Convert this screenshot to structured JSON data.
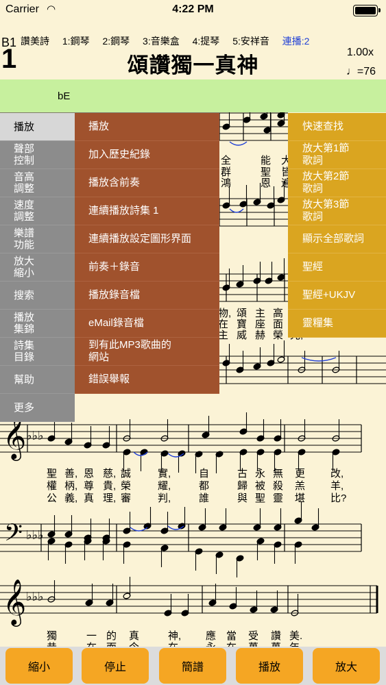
{
  "status": {
    "carrier": "Carrier",
    "time": "4:22 PM"
  },
  "header": {
    "book": "B1",
    "number": "1",
    "title": "頌讚獨一真神",
    "speed": "1.00x",
    "tempo": "♩=76",
    "key": "bE",
    "tracks": [
      "讚美詩",
      "1:鋼琴",
      "2:鋼琴",
      "3:音樂盒",
      "4:提琴",
      "5:安祥音"
    ],
    "lianbo": "連播:2"
  },
  "menu_left": [
    "播放",
    "聲部\n控制",
    "音高\n調整",
    "速度\n調整",
    "樂譜\n功能",
    "放大\n縮小",
    "搜索",
    "播放\n集錦",
    "詩集\n目錄",
    "幫助",
    "更多"
  ],
  "menu_mid": [
    "播放",
    "加入歷史紀錄",
    "播放含前奏",
    "連續播放詩集 1",
    "連續播放設定圖形界面",
    "前奏＋錄音",
    "播放錄音檔",
    "eMail錄音檔",
    "到有此MP3歌曲的\n網站",
    "錯誤舉報"
  ],
  "menu_right": [
    "快速查找",
    "放大第1節\n歌詞",
    "放大第2節\n歌詞",
    "放大第3節\n歌詞",
    "顯示全部歌詞",
    "聖經",
    "聖經+UKJV",
    "靈糧集"
  ],
  "lyrics": {
    "row1": [
      "全",
      "能",
      "大"
    ],
    "row2": [
      "群",
      "聖",
      "皆"
    ],
    "row3": [
      "鴻",
      "恩",
      "遍"
    ],
    "row4": [
      "物,",
      "頌",
      "主",
      "高",
      "而"
    ],
    "row5": [
      "在",
      "寶",
      "座",
      "面"
    ],
    "row6": [
      "主",
      "威",
      "赫",
      "榮",
      "光,"
    ],
    "line2_v1": [
      "聖",
      "善,",
      "恩",
      "慈,",
      "誠",
      "實,",
      "自",
      "古",
      "永",
      "無",
      "更",
      "改,"
    ],
    "line2_v2": [
      "權",
      "柄,",
      "尊",
      "貴,",
      "榮",
      "耀,",
      "都",
      "歸",
      "被",
      "殺",
      "羔",
      "羊,"
    ],
    "line2_v3": [
      "公",
      "義,",
      "真",
      "理,",
      "審",
      "判,",
      "誰",
      "與",
      "聖",
      "靈",
      "堪",
      "比?"
    ],
    "line3_v1": [
      "獨",
      "一",
      "的",
      "真",
      "神,",
      "應",
      "當",
      "受",
      "讚",
      "美."
    ],
    "line3_v2": [
      "昔",
      "在",
      "而",
      "今",
      "在,",
      "永",
      "在",
      "萬",
      "萬",
      "年."
    ]
  },
  "bottom_buttons": [
    "縮小",
    "停止",
    "簡譜",
    "播放",
    "放大"
  ],
  "colors": {
    "background": "#fbf3d6",
    "key_bar": "#c7f09e",
    "menu_left": "#8c8c8c",
    "menu_left_selected": "#d7d7d7",
    "menu_mid": "#a0522d",
    "menu_right": "#daa520",
    "bottom_button": "#f5a623",
    "lianbo": "#1f3fd6"
  }
}
